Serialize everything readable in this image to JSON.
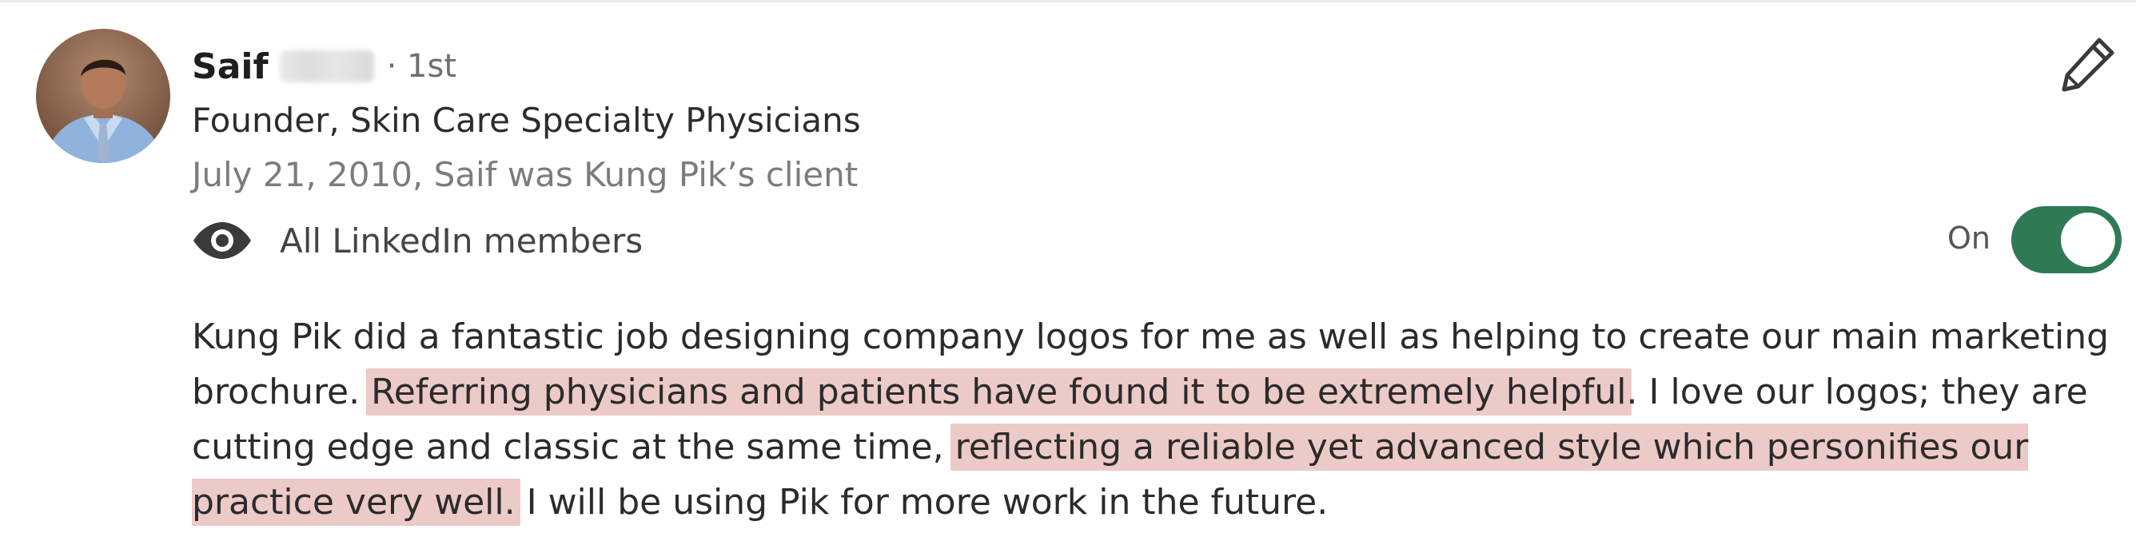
{
  "recommender": {
    "first_name": "Saif",
    "degree": "· 1st",
    "headline": "Founder, Skin Care Specialty Physicians",
    "meta": "July 21, 2010, Saif was Kung Pik’s client"
  },
  "visibility": {
    "icon": "eye-icon",
    "label": "All LinkedIn members"
  },
  "toggle": {
    "label": "On",
    "state": "on",
    "color": "#2f7a55"
  },
  "edit": {
    "icon": "pencil-icon"
  },
  "recommendation": {
    "segments": [
      {
        "text": "Kung Pik did a fantastic job designing company logos for me as well as helping to create our main marketing brochure. ",
        "highlight": false
      },
      {
        "text": "Referring physicians and patients have found it to be extremely helpful",
        "highlight": true
      },
      {
        "text": ". I love our logos; they are cutting edge and classic at the same time, ",
        "highlight": false
      },
      {
        "text": "reflecting a reliable yet advanced style which personifies our practice very well.",
        "highlight": true
      },
      {
        "text": " I will be using Pik for more work in the future.",
        "highlight": false
      }
    ],
    "highlight_color": "#eccac8"
  }
}
